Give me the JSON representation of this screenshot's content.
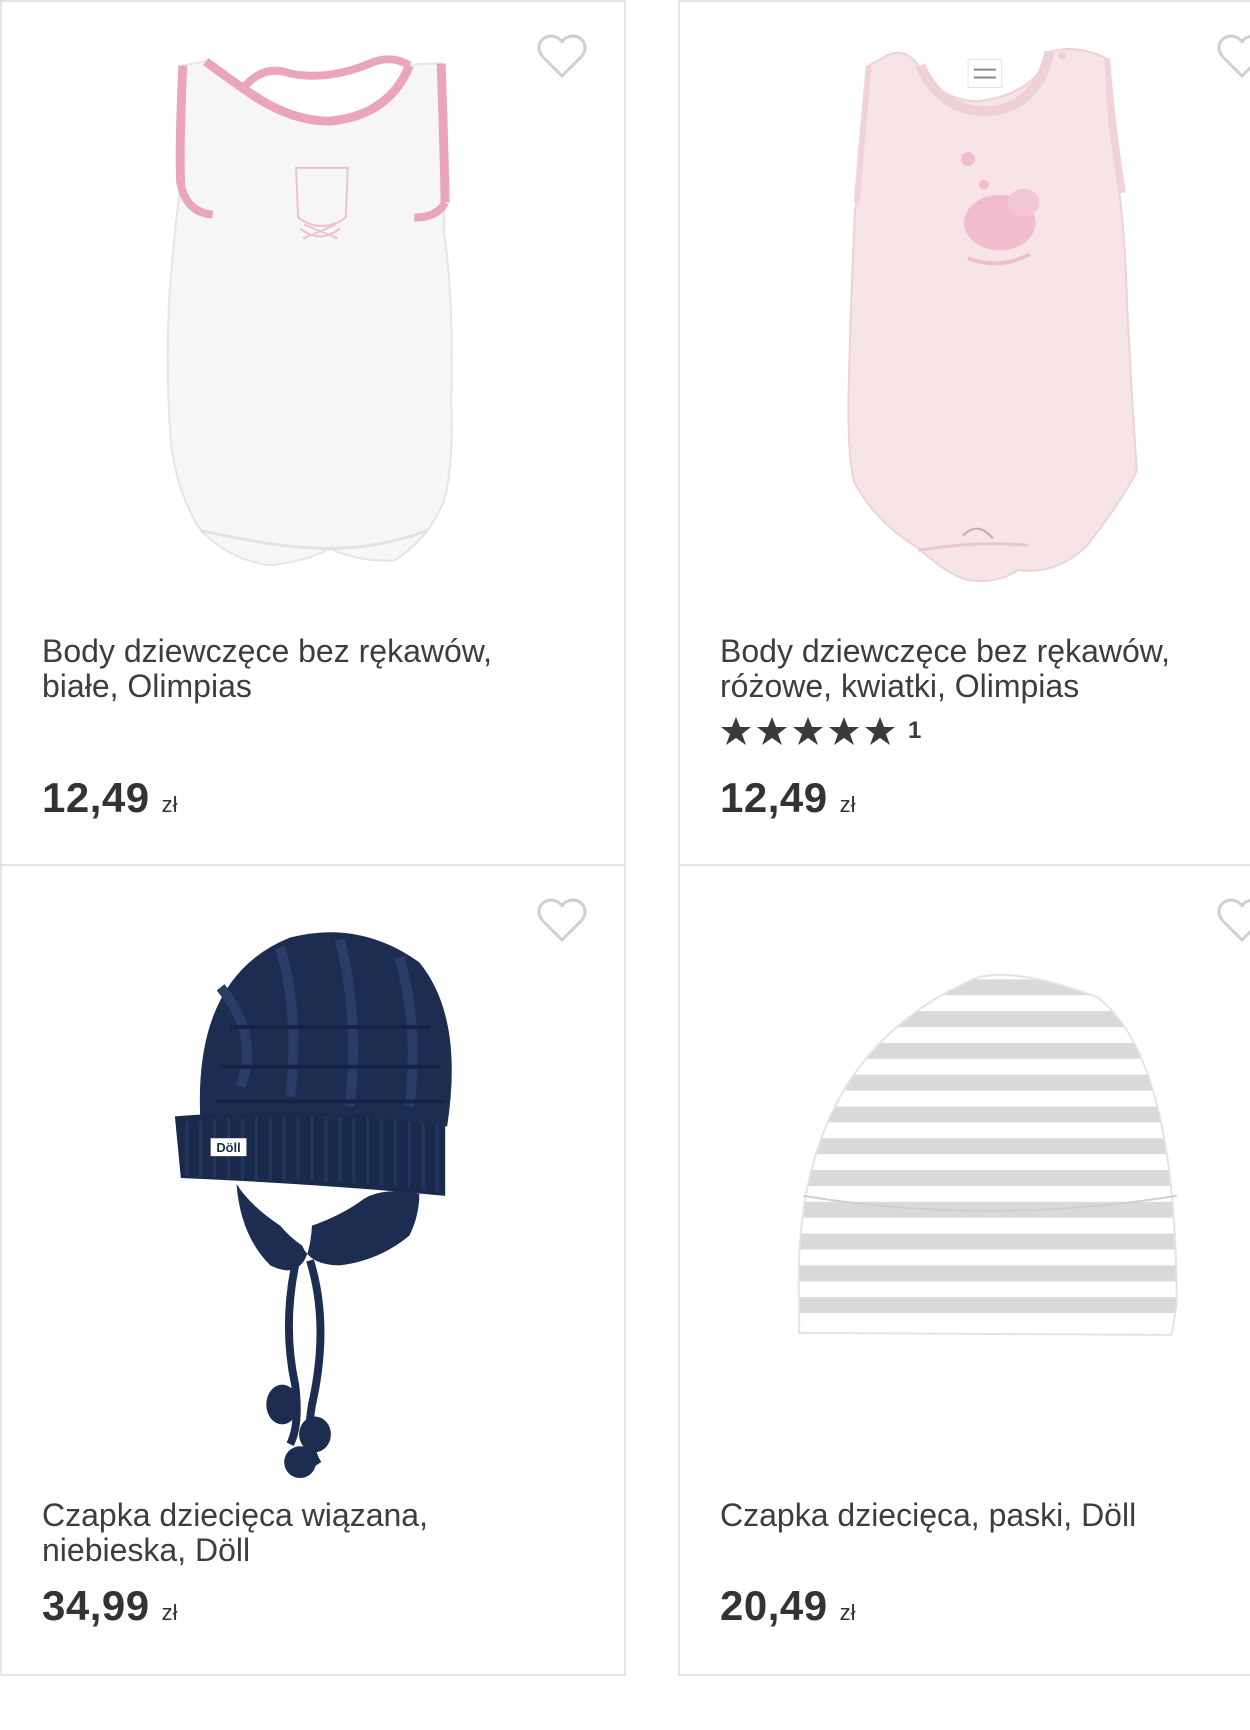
{
  "products": [
    {
      "title_line1": "Body dziewczęce bez rękawów,",
      "title_line2": "białe, Olimpias",
      "price": "12,49",
      "currency": "zł",
      "favorite_icon": "heart-outline-icon",
      "image": "white-sleeveless-bodysuit-pink-trim"
    },
    {
      "title_line1": "Body dziewczęce bez rękawów,",
      "title_line2": "różowe, kwiatki, Olimpias",
      "rating": {
        "stars": 5,
        "max": 5,
        "count": "1"
      },
      "price": "12,49",
      "currency": "zł",
      "favorite_icon": "heart-outline-icon",
      "image": "pink-sleeveless-bodysuit-flower-embroidery"
    },
    {
      "title_line1": "Czapka dziecięca wiązana,",
      "title_line2": "niebieska, Döll",
      "price": "34,99",
      "currency": "zł",
      "favorite_icon": "heart-outline-icon",
      "image": "navy-knit-hat-with-ties",
      "brand_tag": "Döll"
    },
    {
      "title_line1": "Czapka dziecięca, paski, Döll",
      "title_line2": "",
      "price": "20,49",
      "currency": "zł",
      "favorite_icon": "heart-outline-icon",
      "image": "grey-white-striped-hat"
    }
  ],
  "colors": {
    "heart_outline": "#cfcfcf",
    "star": "#3a3a3a",
    "card_border": "#e4e4e4",
    "text": "#3d3d3d"
  }
}
